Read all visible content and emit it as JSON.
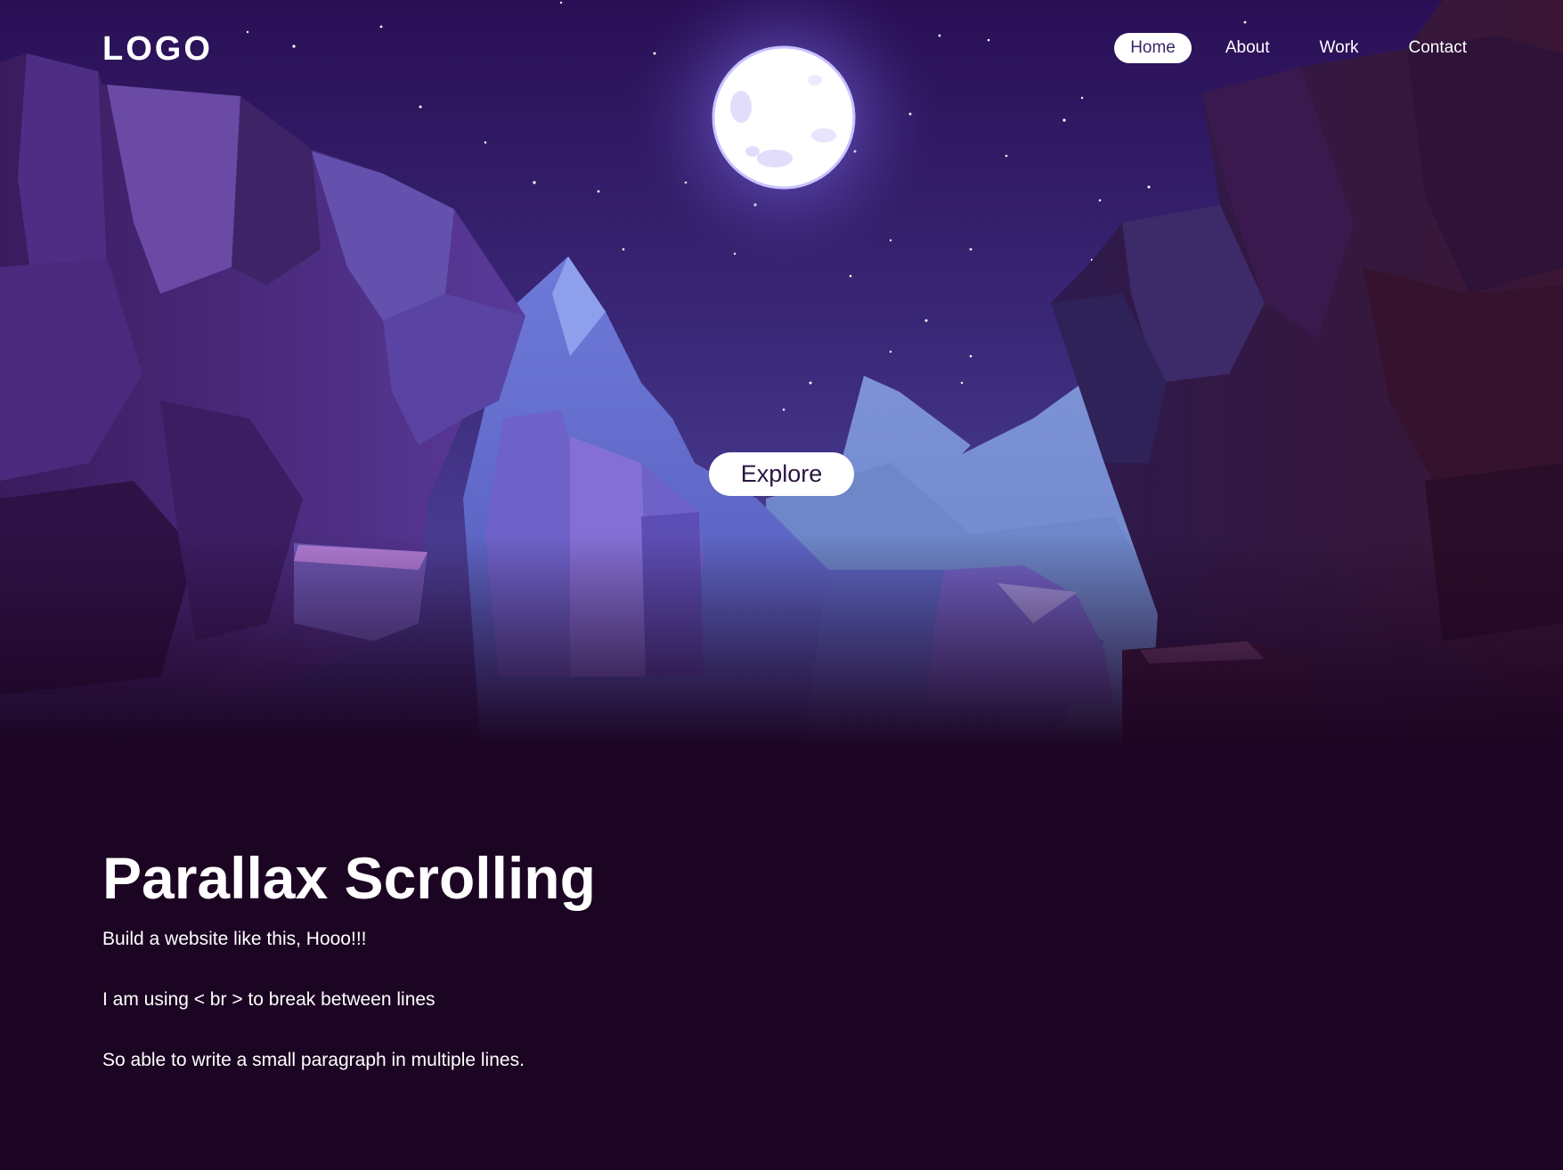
{
  "header": {
    "logo": "LOGO",
    "nav": [
      {
        "label": "Home",
        "active": true
      },
      {
        "label": "About",
        "active": false
      },
      {
        "label": "Work",
        "active": false
      },
      {
        "label": "Contact",
        "active": false
      }
    ]
  },
  "hero": {
    "explore_label": "Explore",
    "scene": "night-sky-moon-canyon-illustration"
  },
  "content": {
    "title": "Parallax Scrolling",
    "lines": [
      "Build a website like this, Hooo!!!",
      "I am using < br > to break between lines",
      "So able to write a small paragraph in multiple lines."
    ]
  },
  "colors": {
    "background": "#1c0522",
    "sky_top": "#2c1259",
    "sky_bottom": "#56469a",
    "nav_active_bg": "#ffffff",
    "nav_active_text": "#3b2466",
    "text": "#ffffff"
  }
}
